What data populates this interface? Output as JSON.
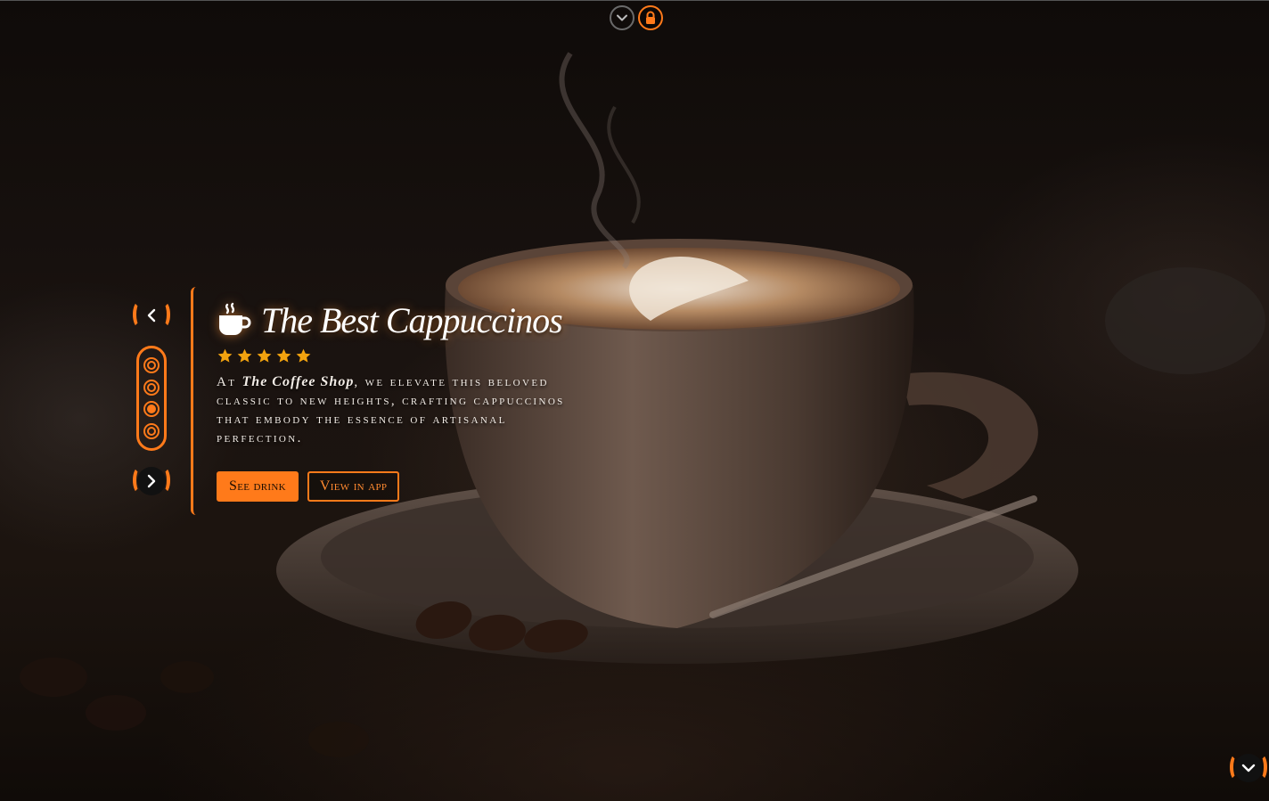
{
  "colors": {
    "accent": "#ff7a1a",
    "background": "#140f0c",
    "text": "#ffffff"
  },
  "top_bar": {
    "collapse_icon": "chevron-down-icon",
    "lock_icon": "lock-icon"
  },
  "carousel": {
    "prev_icon": "chevron-left-icon",
    "next_icon": "chevron-right-icon",
    "slide_count": 4,
    "active_slide": 3
  },
  "hero": {
    "icon": "coffee-cup-icon",
    "title": "The Best Cappuccinos",
    "rating": 5,
    "rating_max": 5,
    "description_prefix": "At",
    "shop_name": "The Coffee Shop",
    "description_suffix": ", we elevate this beloved classic to new heights, crafting cappuccinos that embody the essence of artisanal perfection.",
    "primary_button": "See drink",
    "secondary_button": "View in app"
  },
  "corner": {
    "scroll_icon": "chevron-down-icon"
  }
}
